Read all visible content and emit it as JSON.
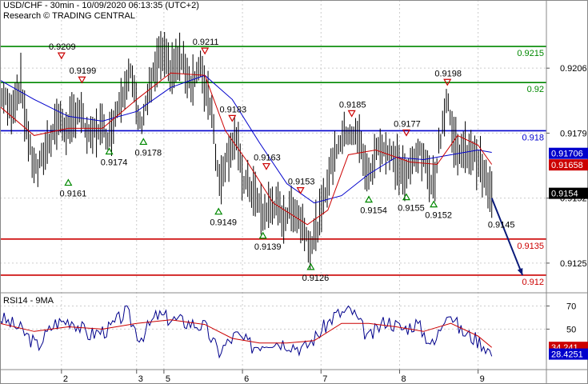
{
  "header": {
    "title": "USD/CHF - 30min - 10/09/2020 06:13:35 (UTC+2)",
    "credit": "Research © TRADING CENTRAL"
  },
  "colors": {
    "price": "#000000",
    "ma_fast": "#cc0000",
    "ma_slow": "#0000cc",
    "support": "#cc0000",
    "resistance": "#008800",
    "pivot": "#0000cc",
    "forecast_arrow": "#0a1a7a",
    "rsi": "#00008b",
    "rsi_ma": "#cc0000",
    "badge_blue": "#0000cc",
    "badge_red": "#cc0000",
    "badge_black": "#000000",
    "up_marker": "#008800",
    "down_marker": "#cc0000"
  },
  "chart_data": [
    {
      "type": "line",
      "panel": "price",
      "title": "USD/CHF - 30min - 10/09/2020 06:13:35 (UTC+2)",
      "x_tick_labels": [
        "2",
        "3",
        "5",
        "6",
        "7",
        "8",
        "9"
      ],
      "y_tick_labels": [
        "0.9206",
        "0.9179",
        "0.9152",
        "0.9125"
      ],
      "ylim": [
        0.9113,
        0.9227
      ],
      "grid": true,
      "horizontal_levels": [
        {
          "value": 0.9215,
          "label": "0.9215",
          "kind": "resistance"
        },
        {
          "value": 0.92,
          "label": "0.92",
          "kind": "resistance"
        },
        {
          "value": 0.918,
          "label": "0.918",
          "kind": "pivot"
        },
        {
          "value": 0.9135,
          "label": "0.9135",
          "kind": "support"
        },
        {
          "value": 0.912,
          "label": "0.912",
          "kind": "support"
        }
      ],
      "current_value_badges": [
        {
          "value": 0.91706,
          "label": "0.91706",
          "color": "blue"
        },
        {
          "value": 0.91658,
          "label": "0.91658",
          "color": "red"
        },
        {
          "value": 0.9154,
          "label": "0.9154",
          "color": "black"
        }
      ],
      "swing_labels": [
        {
          "text": "0.9209",
          "value": 0.9209,
          "kind": "high",
          "x": 0.9
        },
        {
          "text": "0.9199",
          "value": 0.9199,
          "kind": "high",
          "x": 1.2
        },
        {
          "text": "0.9161",
          "value": 0.9161,
          "kind": "low",
          "x": 1.0
        },
        {
          "text": "0.9174",
          "value": 0.9174,
          "kind": "low",
          "x": 1.6
        },
        {
          "text": "0.9178",
          "value": 0.9178,
          "kind": "low",
          "x": 2.1
        },
        {
          "text": "0.9211",
          "value": 0.9211,
          "kind": "high",
          "x": 3.0
        },
        {
          "text": "0.9183",
          "value": 0.9183,
          "kind": "high",
          "x": 3.4
        },
        {
          "text": "0.9149",
          "value": 0.9149,
          "kind": "low",
          "x": 3.2
        },
        {
          "text": "0.9163",
          "value": 0.9163,
          "kind": "high",
          "x": 3.9
        },
        {
          "text": "0.9139",
          "value": 0.9139,
          "kind": "low",
          "x": 3.85
        },
        {
          "text": "0.9153",
          "value": 0.9153,
          "kind": "high",
          "x": 4.4
        },
        {
          "text": "0.9126",
          "value": 0.9126,
          "kind": "low",
          "x": 4.55
        },
        {
          "text": "0.9185",
          "value": 0.9185,
          "kind": "high",
          "x": 5.15
        },
        {
          "text": "0.9154",
          "value": 0.9154,
          "kind": "low",
          "x": 5.4
        },
        {
          "text": "0.9177",
          "value": 0.9177,
          "kind": "high",
          "x": 5.95
        },
        {
          "text": "0.9155",
          "value": 0.9155,
          "kind": "low",
          "x": 5.95
        },
        {
          "text": "0.9152",
          "value": 0.9152,
          "kind": "low",
          "x": 6.35
        },
        {
          "text": "0.9198",
          "value": 0.9198,
          "kind": "high",
          "x": 6.55
        },
        {
          "text": "0.9145",
          "value": 0.9145,
          "kind": "target",
          "x": 7.2
        }
      ],
      "price_path": [
        {
          "x": 0.0,
          "y": 0.9197
        },
        {
          "x": 0.15,
          "y": 0.9188
        },
        {
          "x": 0.3,
          "y": 0.92
        },
        {
          "x": 0.45,
          "y": 0.917
        },
        {
          "x": 0.55,
          "y": 0.9163
        },
        {
          "x": 0.7,
          "y": 0.9175
        },
        {
          "x": 0.85,
          "y": 0.9185
        },
        {
          "x": 1.0,
          "y": 0.918
        },
        {
          "x": 1.15,
          "y": 0.919
        },
        {
          "x": 1.3,
          "y": 0.9176
        },
        {
          "x": 1.45,
          "y": 0.9182
        },
        {
          "x": 1.6,
          "y": 0.9178
        },
        {
          "x": 1.75,
          "y": 0.9193
        },
        {
          "x": 1.9,
          "y": 0.9205
        },
        {
          "x": 2.05,
          "y": 0.9182
        },
        {
          "x": 2.2,
          "y": 0.9198
        },
        {
          "x": 2.35,
          "y": 0.9212
        },
        {
          "x": 2.5,
          "y": 0.9205
        },
        {
          "x": 2.65,
          "y": 0.921
        },
        {
          "x": 2.8,
          "y": 0.92
        },
        {
          "x": 2.95,
          "y": 0.9206
        },
        {
          "x": 3.0,
          "y": 0.9198
        },
        {
          "x": 3.1,
          "y": 0.919
        },
        {
          "x": 3.2,
          "y": 0.9158
        },
        {
          "x": 3.3,
          "y": 0.9168
        },
        {
          "x": 3.45,
          "y": 0.9178
        },
        {
          "x": 3.55,
          "y": 0.916
        },
        {
          "x": 3.7,
          "y": 0.9155
        },
        {
          "x": 3.85,
          "y": 0.9145
        },
        {
          "x": 4.0,
          "y": 0.915
        },
        {
          "x": 4.15,
          "y": 0.9144
        },
        {
          "x": 4.3,
          "y": 0.9148
        },
        {
          "x": 4.45,
          "y": 0.914
        },
        {
          "x": 4.55,
          "y": 0.9132
        },
        {
          "x": 4.7,
          "y": 0.9145
        },
        {
          "x": 4.8,
          "y": 0.916
        },
        {
          "x": 4.95,
          "y": 0.9175
        },
        {
          "x": 5.1,
          "y": 0.918
        },
        {
          "x": 5.25,
          "y": 0.9177
        },
        {
          "x": 5.4,
          "y": 0.916
        },
        {
          "x": 5.55,
          "y": 0.9175
        },
        {
          "x": 5.7,
          "y": 0.917
        },
        {
          "x": 5.85,
          "y": 0.9165
        },
        {
          "x": 5.95,
          "y": 0.916
        },
        {
          "x": 6.1,
          "y": 0.9172
        },
        {
          "x": 6.25,
          "y": 0.9165
        },
        {
          "x": 6.35,
          "y": 0.9158
        },
        {
          "x": 6.45,
          "y": 0.9178
        },
        {
          "x": 6.55,
          "y": 0.9195
        },
        {
          "x": 6.62,
          "y": 0.9178
        },
        {
          "x": 6.75,
          "y": 0.917
        },
        {
          "x": 6.9,
          "y": 0.9172
        },
        {
          "x": 7.0,
          "y": 0.9168
        },
        {
          "x": 7.1,
          "y": 0.916
        },
        {
          "x": 7.2,
          "y": 0.9152
        }
      ],
      "ma_fast": [
        {
          "x": 0.0,
          "y": 0.919
        },
        {
          "x": 0.5,
          "y": 0.9178
        },
        {
          "x": 1.0,
          "y": 0.9181
        },
        {
          "x": 1.5,
          "y": 0.9181
        },
        {
          "x": 2.0,
          "y": 0.9193
        },
        {
          "x": 2.5,
          "y": 0.9204
        },
        {
          "x": 3.0,
          "y": 0.9203
        },
        {
          "x": 3.3,
          "y": 0.918
        },
        {
          "x": 3.6,
          "y": 0.9168
        },
        {
          "x": 4.0,
          "y": 0.915
        },
        {
          "x": 4.5,
          "y": 0.9141
        },
        {
          "x": 4.8,
          "y": 0.9147
        },
        {
          "x": 5.1,
          "y": 0.917
        },
        {
          "x": 5.5,
          "y": 0.9172
        },
        {
          "x": 6.0,
          "y": 0.9167
        },
        {
          "x": 6.4,
          "y": 0.9166
        },
        {
          "x": 6.7,
          "y": 0.9178
        },
        {
          "x": 7.0,
          "y": 0.9174
        },
        {
          "x": 7.2,
          "y": 0.9166
        }
      ],
      "ma_slow": [
        {
          "x": 0.0,
          "y": 0.9201
        },
        {
          "x": 0.5,
          "y": 0.9193
        },
        {
          "x": 1.0,
          "y": 0.9186
        },
        {
          "x": 1.5,
          "y": 0.9184
        },
        {
          "x": 2.0,
          "y": 0.9188
        },
        {
          "x": 2.5,
          "y": 0.9198
        },
        {
          "x": 3.0,
          "y": 0.9203
        },
        {
          "x": 3.4,
          "y": 0.9193
        },
        {
          "x": 3.8,
          "y": 0.9175
        },
        {
          "x": 4.2,
          "y": 0.9158
        },
        {
          "x": 4.6,
          "y": 0.915
        },
        {
          "x": 5.0,
          "y": 0.9153
        },
        {
          "x": 5.4,
          "y": 0.9162
        },
        {
          "x": 5.8,
          "y": 0.9169
        },
        {
          "x": 6.2,
          "y": 0.9168
        },
        {
          "x": 6.6,
          "y": 0.917
        },
        {
          "x": 7.0,
          "y": 0.9172
        },
        {
          "x": 7.2,
          "y": 0.9171
        }
      ],
      "forecast_arrow": {
        "from": {
          "x": 7.2,
          "y": 0.9152
        },
        "to": {
          "x": 7.65,
          "y": 0.912
        }
      }
    },
    {
      "type": "line",
      "panel": "indicator",
      "title": "RSI14 - 9MA",
      "y_tick_labels": [
        "70",
        "50"
      ],
      "ylim": [
        15,
        80
      ],
      "current_value_badges": [
        {
          "value": 34.241,
          "label": "34.241",
          "color": "red"
        },
        {
          "value": 28.4251,
          "label": "28.4251",
          "color": "blue"
        }
      ],
      "series": [
        {
          "name": "RSI14",
          "values": [
            {
              "x": 0.0,
              "y": 60
            },
            {
              "x": 0.3,
              "y": 50
            },
            {
              "x": 0.55,
              "y": 35
            },
            {
              "x": 0.8,
              "y": 55
            },
            {
              "x": 1.05,
              "y": 58
            },
            {
              "x": 1.3,
              "y": 45
            },
            {
              "x": 1.6,
              "y": 50
            },
            {
              "x": 1.85,
              "y": 65
            },
            {
              "x": 2.05,
              "y": 42
            },
            {
              "x": 2.3,
              "y": 62
            },
            {
              "x": 2.55,
              "y": 58
            },
            {
              "x": 2.8,
              "y": 55
            },
            {
              "x": 3.0,
              "y": 52
            },
            {
              "x": 3.2,
              "y": 30
            },
            {
              "x": 3.45,
              "y": 45
            },
            {
              "x": 3.7,
              "y": 35
            },
            {
              "x": 3.95,
              "y": 40
            },
            {
              "x": 4.2,
              "y": 38
            },
            {
              "x": 4.45,
              "y": 33
            },
            {
              "x": 4.65,
              "y": 45
            },
            {
              "x": 4.9,
              "y": 62
            },
            {
              "x": 5.15,
              "y": 66
            },
            {
              "x": 5.4,
              "y": 42
            },
            {
              "x": 5.65,
              "y": 58
            },
            {
              "x": 5.9,
              "y": 50
            },
            {
              "x": 6.1,
              "y": 55
            },
            {
              "x": 6.35,
              "y": 35
            },
            {
              "x": 6.55,
              "y": 68
            },
            {
              "x": 6.75,
              "y": 48
            },
            {
              "x": 6.95,
              "y": 42
            },
            {
              "x": 7.1,
              "y": 36
            },
            {
              "x": 7.2,
              "y": 28.4251
            }
          ]
        },
        {
          "name": "9MA",
          "values": [
            {
              "x": 0.0,
              "y": 55
            },
            {
              "x": 0.5,
              "y": 48
            },
            {
              "x": 1.0,
              "y": 52
            },
            {
              "x": 1.5,
              "y": 50
            },
            {
              "x": 2.0,
              "y": 55
            },
            {
              "x": 2.5,
              "y": 58
            },
            {
              "x": 3.0,
              "y": 54
            },
            {
              "x": 3.4,
              "y": 42
            },
            {
              "x": 3.8,
              "y": 38
            },
            {
              "x": 4.2,
              "y": 38
            },
            {
              "x": 4.6,
              "y": 40
            },
            {
              "x": 5.0,
              "y": 55
            },
            {
              "x": 5.4,
              "y": 55
            },
            {
              "x": 5.8,
              "y": 52
            },
            {
              "x": 6.2,
              "y": 48
            },
            {
              "x": 6.6,
              "y": 55
            },
            {
              "x": 7.0,
              "y": 44
            },
            {
              "x": 7.2,
              "y": 34.241
            }
          ]
        }
      ]
    }
  ]
}
